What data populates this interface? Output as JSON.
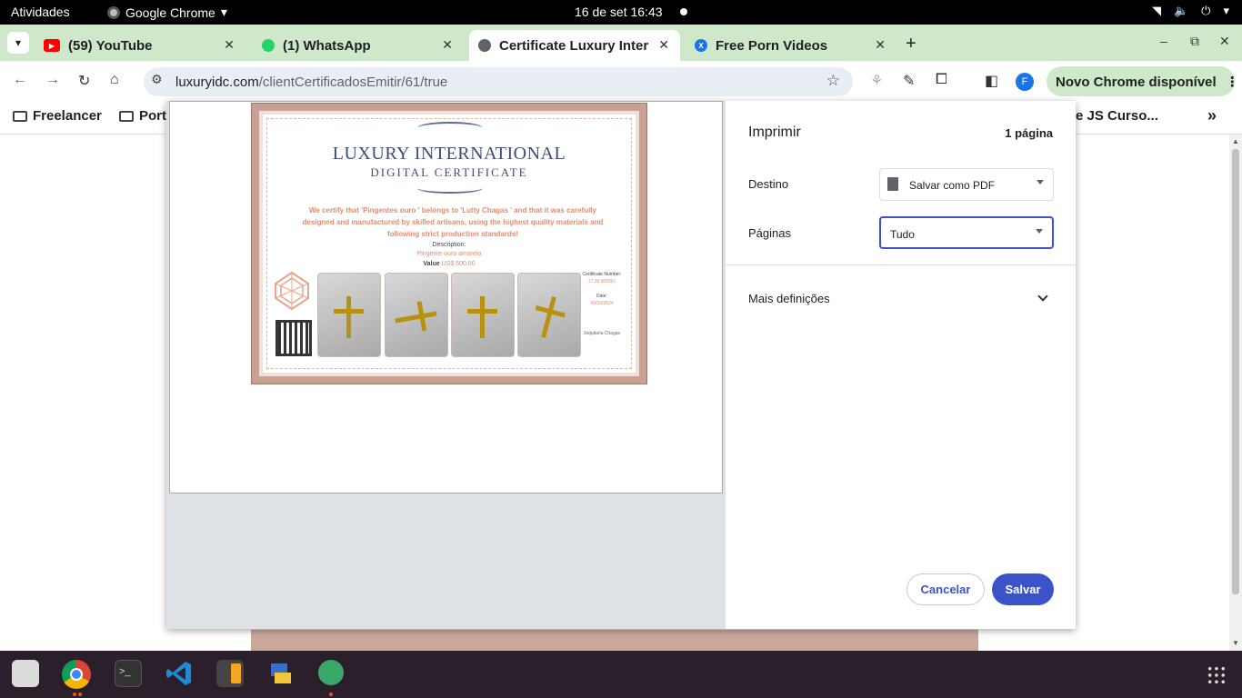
{
  "topbar": {
    "activities": "Atividades",
    "app_name": "Google Chrome",
    "clock": "16 de set  16:43"
  },
  "tabs": [
    {
      "title": "(59) YouTube",
      "favicon": "youtube-icon",
      "active": false
    },
    {
      "title": "(1) WhatsApp",
      "favicon": "whatsapp-icon",
      "active": false
    },
    {
      "title": "Certificate Luxury Intern",
      "favicon": "globe-icon",
      "active": true
    },
    {
      "title": "Free Porn Videos",
      "favicon": "x-icon",
      "active": false
    }
  ],
  "toolbar": {
    "url_host": "luxuryidc.com",
    "url_path": "/clientCertificadosEmitir/61/true",
    "profile_initial": "F",
    "update_label": "Novo Chrome disponível"
  },
  "bookmarks": {
    "items": [
      "Freelancer",
      "Port"
    ],
    "right_item": "e JS Curso..."
  },
  "certificate": {
    "title": "LUXURY INTERNATIONAL",
    "subtitle": "DIGITAL CERTIFICATE",
    "statement_1": "We certify that 'Pingentes ouro ' belongs to 'Lutty Chagas ' and that it was carefully",
    "statement_2": "designed and manufactured by skilled artisans, using the highest quality materials and",
    "statement_3": "following strict production standards!",
    "description_label": "Description:",
    "description": "Pingente ouro amarelo",
    "value_label": "Value",
    "value": "US$ 500,00",
    "cert_number_label": "Certificate Number:",
    "cert_number": "17.28.000061",
    "date_label": "Date:",
    "date": "09/16/2024",
    "brand": "Joquilaria Chagas"
  },
  "print_dialog": {
    "title": "Imprimir",
    "page_count": "1 página",
    "destination_label": "Destino",
    "destination_value": "Salvar como PDF",
    "pages_label": "Páginas",
    "pages_value": "Tudo",
    "more_settings": "Mais definições",
    "cancel": "Cancelar",
    "save": "Salvar"
  },
  "colors": {
    "accent": "#3c52c9",
    "tabstrip": "#cfe8c9",
    "cert_frame": "#c9a092",
    "cert_text": "#e28c6e"
  }
}
